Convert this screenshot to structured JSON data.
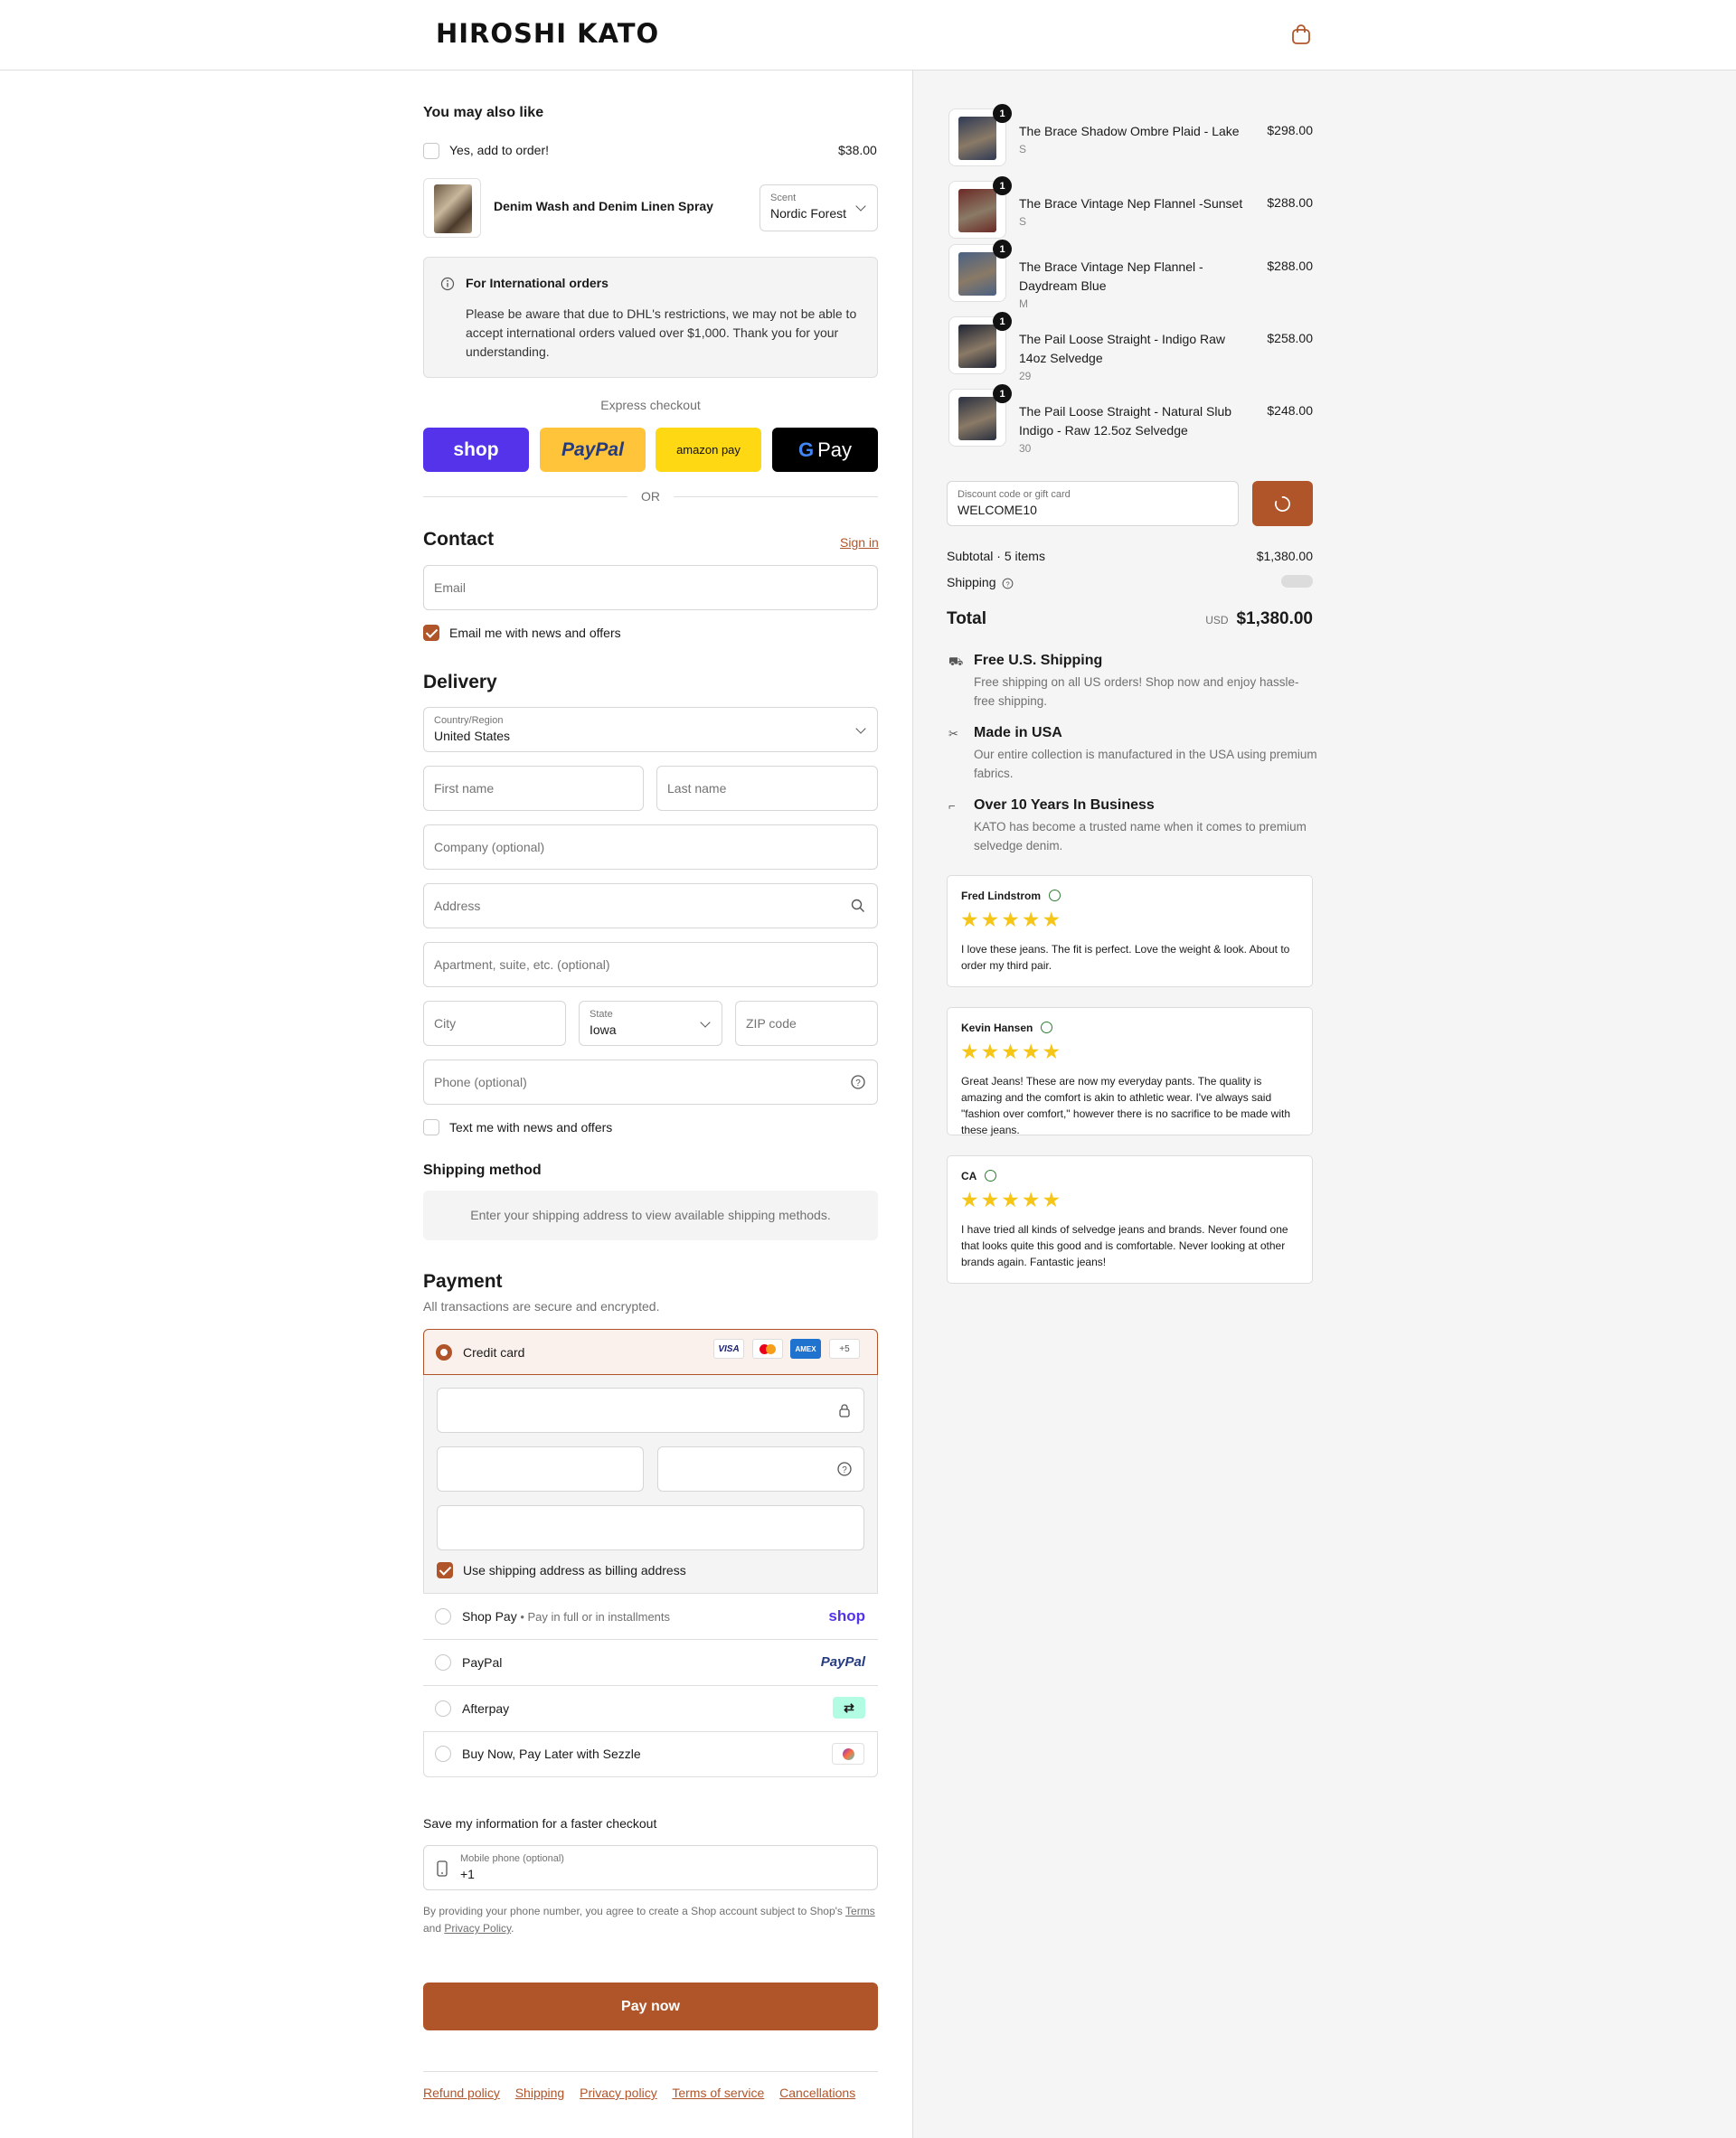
{
  "brand": {
    "logo_text": "HIROSHI KATO",
    "accent": "#b0552a"
  },
  "upsell": {
    "heading": "You may also like",
    "add_label": "Yes, add to order!",
    "price": "$38.00",
    "product_name": "Denim Wash and Denim Linen Spray",
    "scent_label": "Scent",
    "scent_value": "Nordic Forest"
  },
  "notice": {
    "title": "For International orders",
    "body": "Please be aware that due to DHL's restrictions, we may not be able to accept international orders valued over $1,000. Thank you for your understanding."
  },
  "express": {
    "label": "Express checkout",
    "shop": "shop",
    "paypal": "PayPal",
    "amazon": "amazon pay",
    "gpay": "Pay",
    "or": "OR"
  },
  "contact": {
    "heading": "Contact",
    "sign_in": "Sign in",
    "email_placeholder": "Email",
    "news_label": "Email me with news and offers"
  },
  "delivery": {
    "heading": "Delivery",
    "country_label": "Country/Region",
    "country_value": "United States",
    "first_name": "First name",
    "last_name": "Last name",
    "company": "Company (optional)",
    "address": "Address",
    "apartment": "Apartment, suite, etc. (optional)",
    "city": "City",
    "state_label": "State",
    "state_value": "Iowa",
    "zip": "ZIP code",
    "phone": "Phone (optional)",
    "text_label": "Text me with news and offers"
  },
  "shipping_method": {
    "heading": "Shipping method",
    "message": "Enter your shipping address to view available shipping methods."
  },
  "payment": {
    "heading": "Payment",
    "subtitle": "All transactions are secure and encrypted.",
    "credit_card": "Credit card",
    "card_brands": [
      "VISA",
      "AMEX"
    ],
    "more_cards": "+5",
    "billing_label": "Use shipping address as billing address",
    "shop_pay": "Shop Pay",
    "shop_pay_sub": "Pay in full or in installments",
    "shop_logo": "shop",
    "paypal": "PayPal",
    "paypal_logo": "PayPal",
    "afterpay": "Afterpay",
    "sezzle": "Buy Now, Pay Later with Sezzle"
  },
  "save_info": {
    "heading": "Save my information for a faster checkout",
    "phone_label": "Mobile phone (optional)",
    "phone_value": "+1",
    "legal_prefix": "By providing your phone number, you agree to create a Shop account subject to Shop's",
    "terms": "Terms",
    "and": "and",
    "privacy": "Privacy Policy",
    "period": "."
  },
  "pay_button": "Pay now",
  "footer_links": [
    "Refund policy",
    "Shipping",
    "Privacy policy",
    "Terms of service",
    "Cancellations"
  ],
  "order": {
    "items": [
      {
        "name": "The Brace Shadow Ombre Plaid - Lake",
        "variant": "S",
        "price": "$298.00",
        "qty": "1",
        "color": "#2f3a55"
      },
      {
        "name": "The Brace Vintage Nep Flannel -Sunset",
        "variant": "S",
        "price": "$288.00",
        "qty": "1",
        "color": "#6b2a26"
      },
      {
        "name": "The Brace Vintage Nep Flannel - Daydream Blue",
        "variant": "M",
        "price": "$288.00",
        "qty": "1",
        "color": "#4a6184"
      },
      {
        "name": "The Pail Loose Straight - Indigo Raw 14oz Selvedge",
        "variant": "29",
        "price": "$258.00",
        "qty": "1",
        "color": "#1f2433"
      },
      {
        "name": "The Pail Loose Straight - Natural Slub Indigo - Raw 12.5oz Selvedge",
        "variant": "30",
        "price": "$248.00",
        "qty": "1",
        "color": "#2a3040"
      }
    ],
    "discount_label": "Discount code or gift card",
    "discount_value": "WELCOME10",
    "subtotal_label": "Subtotal · 5 items",
    "subtotal_value": "$1,380.00",
    "shipping_label": "Shipping",
    "total_label": "Total",
    "currency": "USD",
    "total_value": "$1,380.00"
  },
  "perks": [
    {
      "icon": "truck-icon",
      "title": "Free U.S. Shipping",
      "text": "Free shipping on all US orders! Shop now and enjoy hassle-free shipping."
    },
    {
      "icon": "sewing-machine-icon",
      "title": "Made in USA",
      "text": "Our entire collection is manufactured in the USA using premium fabrics."
    },
    {
      "icon": "boot-icon",
      "title": "Over 10 Years In Business",
      "text": "KATO has become a trusted name when it comes to premium selvedge denim."
    }
  ],
  "reviews": [
    {
      "name": "Fred Lindstrom",
      "rating": 5,
      "text": "I love these jeans. The fit is perfect. Love the weight & look. About to order my third pair."
    },
    {
      "name": "Kevin Hansen",
      "rating": 5,
      "text": "Great Jeans! These are now my everyday pants. The quality is amazing and the comfort is akin to athletic wear. I've always said \"fashion over comfort,\" however there is no sacrifice to be made with these jeans."
    },
    {
      "name": "CA",
      "rating": 5,
      "text": "I have tried all kinds of selvedge jeans and brands. Never found one that looks quite this good and is comfortable. Never looking at other brands again. Fantastic jeans!"
    }
  ],
  "stars_text": "★★★★★"
}
